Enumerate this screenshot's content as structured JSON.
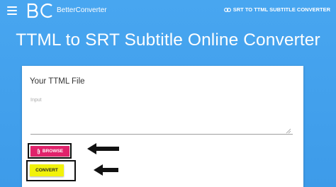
{
  "header": {
    "brand": "BetterConverter",
    "nav_link": "SRT TO TTML SUBTITLE CONVERTER"
  },
  "page": {
    "title": "TTML to SRT Subtitle Online Converter"
  },
  "card": {
    "title": "Your TTML File",
    "input_placeholder": "Input",
    "browse_label": "BROWSE",
    "convert_label": "CONVERT"
  },
  "colors": {
    "background": "#48a6f0",
    "browse": "#e0236b",
    "convert": "#f2f20a"
  },
  "icons": [
    "menu-icon",
    "logo",
    "link-icon",
    "paperclip-icon",
    "arrow-left-icon"
  ]
}
